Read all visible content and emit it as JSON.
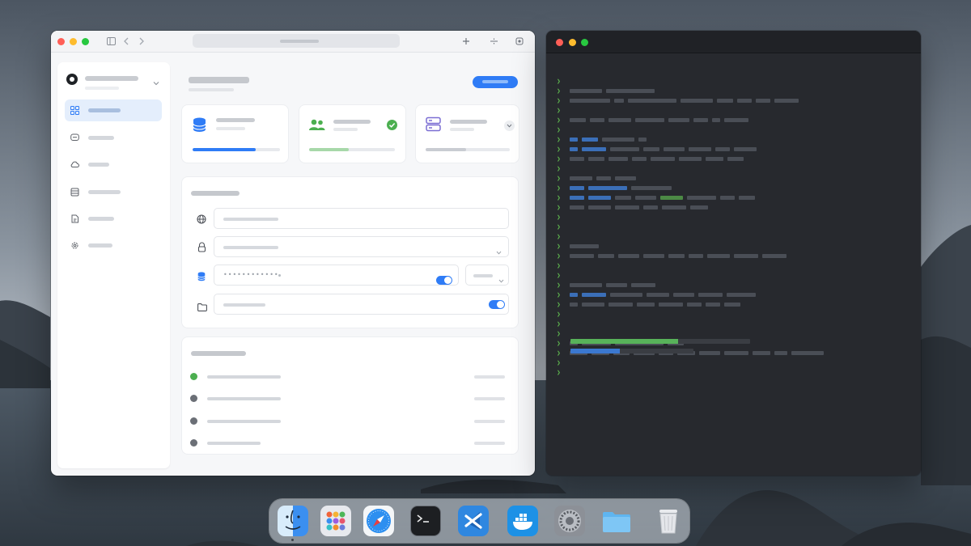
{
  "theme": {
    "accent": "#2f7cf6",
    "success": "#4caf50",
    "terminal_bg": "#27292e",
    "terminal_prompt": "#5fb84f"
  },
  "browser": {
    "toolbar_icons": [
      "sidebar-toggle-icon",
      "back-icon",
      "forward-icon",
      "new-tab-icon",
      "tab-overview-icon",
      "extensions-icon"
    ],
    "sidebar": {
      "items": [
        {
          "icon": "dashboard-icon",
          "active": true
        },
        {
          "icon": "chat-icon",
          "active": false
        },
        {
          "icon": "cloud-icon",
          "active": false
        },
        {
          "icon": "database-icon",
          "active": false
        },
        {
          "icon": "document-icon",
          "active": false
        },
        {
          "icon": "gear-icon",
          "active": false
        }
      ]
    },
    "stats": [
      {
        "icon": "database-icon",
        "progress": 0.72,
        "color": "#2f7cf6",
        "badge": null
      },
      {
        "icon": "users-icon",
        "progress": 0.46,
        "color": "#4caf50",
        "badge": "check-circle-icon"
      },
      {
        "icon": "server-icon",
        "progress": 0.48,
        "color": "#c9ccd2",
        "badge": "chevron-down-icon"
      }
    ],
    "form_fields": [
      {
        "icon": "globe-icon",
        "type": "text",
        "value": ""
      },
      {
        "icon": "lock-icon",
        "type": "select",
        "value": ""
      },
      {
        "icon": "database-icon",
        "type": "password",
        "value": "••••••••••••"
      },
      {
        "icon": "folder-icon",
        "type": "toggle",
        "value": ""
      }
    ],
    "toggles": [
      true,
      true
    ],
    "activity": [
      {
        "status": "active",
        "color": "#4caf50"
      },
      {
        "status": "idle",
        "color": "#6b6f76"
      },
      {
        "status": "idle",
        "color": "#6b6f76"
      },
      {
        "status": "idle",
        "color": "#6b6f76"
      }
    ]
  },
  "terminal": {
    "progress_green": 0.6,
    "progress_blue": 0.3
  },
  "dock": {
    "apps": [
      "finder-icon",
      "launchpad-icon",
      "safari-icon",
      "terminal-icon",
      "vscode-icon",
      "docker-icon",
      "system-settings-icon",
      "folder-icon",
      "trash-icon"
    ]
  }
}
